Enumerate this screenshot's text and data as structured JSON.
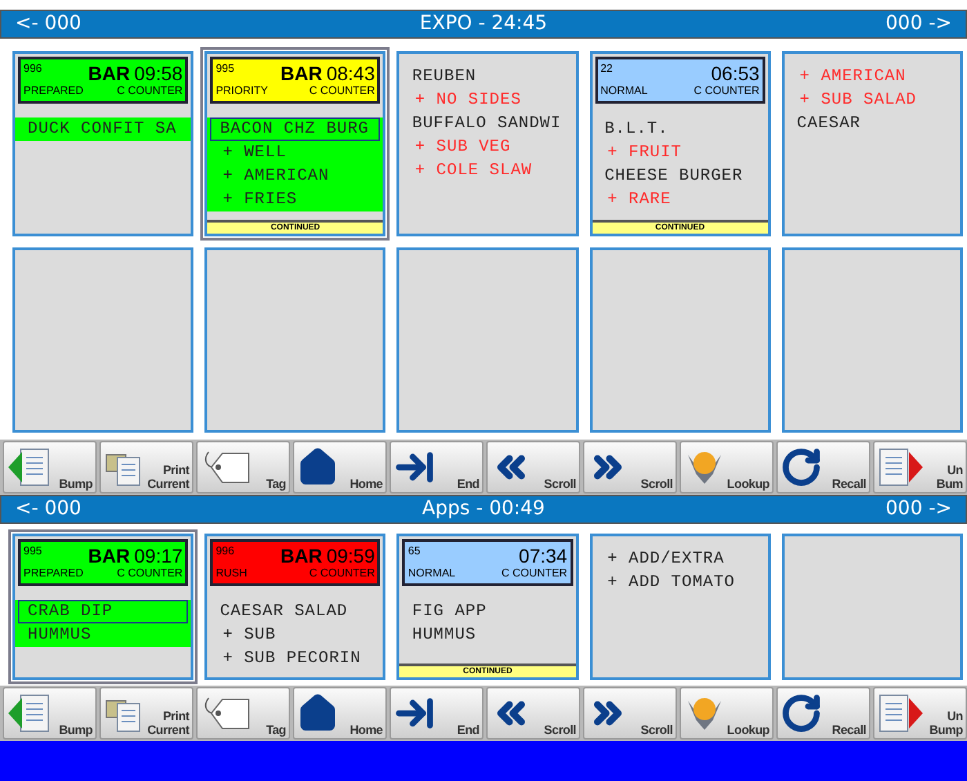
{
  "sections": [
    {
      "left": "<- 000",
      "title": "EXPO - 24:45",
      "right": "000 ->",
      "tickets": [
        {
          "kind": "order",
          "selected": false,
          "number": "996",
          "station": "BAR",
          "time": "09:58",
          "status": "PREPARED",
          "location": "C COUNTER",
          "color": "#00ff00",
          "continued": false,
          "items": [
            {
              "kind": "item",
              "text": "DUCK CONFIT SA",
              "highlight": true,
              "boxed": false
            }
          ]
        },
        {
          "kind": "order",
          "selected": true,
          "number": "995",
          "station": "BAR",
          "time": "08:43",
          "status": "PRIORITY",
          "location": "C COUNTER",
          "color": "#ffff00",
          "continued": true,
          "continued_label": "CONTINUED",
          "items": [
            {
              "kind": "item",
              "text": "BACON CHZ BURG",
              "highlight": true,
              "boxed": true
            },
            {
              "kind": "mod",
              "text": "+ WELL",
              "highlight": true,
              "boxed": false
            },
            {
              "kind": "mod",
              "text": "+ AMERICAN",
              "highlight": true,
              "boxed": false
            },
            {
              "kind": "mod",
              "text": "+ FRIES",
              "highlight": true,
              "boxed": false
            }
          ]
        },
        {
          "kind": "order",
          "selected": false,
          "continued": false,
          "items": [
            {
              "kind": "item",
              "text": "REUBEN",
              "highlight": false,
              "boxed": false
            },
            {
              "kind": "mod",
              "text": "+ NO SIDES",
              "highlight": false,
              "boxed": false
            },
            {
              "kind": "item",
              "text": "BUFFALO SANDWI",
              "highlight": false,
              "boxed": false
            },
            {
              "kind": "mod",
              "text": "+ SUB VEG",
              "highlight": false,
              "boxed": false
            },
            {
              "kind": "mod",
              "text": "+ COLE SLAW",
              "highlight": false,
              "boxed": false
            }
          ]
        },
        {
          "kind": "order",
          "selected": false,
          "number": "22",
          "time": "06:53",
          "status": "NORMAL",
          "location": "C COUNTER",
          "color": "#99ccff",
          "continued": true,
          "continued_label": "CONTINUED",
          "items": [
            {
              "kind": "item",
              "text": "B.L.T.",
              "highlight": false,
              "boxed": false
            },
            {
              "kind": "mod",
              "text": "+ FRUIT",
              "highlight": false,
              "boxed": false
            },
            {
              "kind": "item",
              "text": "CHEESE BURGER",
              "highlight": false,
              "boxed": false
            },
            {
              "kind": "mod",
              "text": "+ RARE",
              "highlight": false,
              "boxed": false
            }
          ]
        },
        {
          "kind": "order",
          "selected": false,
          "continued": false,
          "items": [
            {
              "kind": "mod",
              "text": "+ AMERICAN",
              "highlight": false,
              "boxed": false
            },
            {
              "kind": "mod",
              "text": "+ SUB SALAD",
              "highlight": false,
              "boxed": false
            },
            {
              "kind": "item",
              "text": "CAESAR",
              "highlight": false,
              "boxed": false
            }
          ]
        },
        {
          "kind": "empty"
        },
        {
          "kind": "empty"
        },
        {
          "kind": "empty"
        },
        {
          "kind": "empty"
        },
        {
          "kind": "empty"
        }
      ],
      "toolbar": [
        {
          "kind": "bump",
          "lines": [
            "Bump"
          ]
        },
        {
          "kind": "print",
          "lines": [
            "Print",
            "Current"
          ]
        },
        {
          "kind": "tag",
          "lines": [
            "Tag"
          ]
        },
        {
          "kind": "home",
          "lines": [
            "Home"
          ]
        },
        {
          "kind": "end",
          "lines": [
            "End"
          ]
        },
        {
          "kind": "back",
          "lines": [
            "Scroll"
          ]
        },
        {
          "kind": "forward",
          "lines": [
            "Scroll"
          ]
        },
        {
          "kind": "lookup",
          "lines": [
            "Lookup"
          ]
        },
        {
          "kind": "recall",
          "lines": [
            "Recall"
          ]
        },
        {
          "kind": "unbump",
          "lines": [
            "Un",
            "Bum"
          ]
        }
      ]
    },
    {
      "left": "<- 000",
      "title": "Apps - 00:49",
      "right": "000 ->",
      "tickets": [
        {
          "kind": "order",
          "selected": true,
          "number": "995",
          "station": "BAR",
          "time": "09:17",
          "status": "PREPARED",
          "location": "C COUNTER",
          "color": "#00ff00",
          "continued": false,
          "items": [
            {
              "kind": "item",
              "text": "CRAB DIP",
              "highlight": true,
              "boxed": true
            },
            {
              "kind": "item",
              "text": "HUMMUS",
              "highlight": true,
              "boxed": false
            }
          ]
        },
        {
          "kind": "order",
          "selected": false,
          "number": "996",
          "station": "BAR",
          "time": "09:59",
          "status": "RUSH",
          "location": "C COUNTER",
          "color": "#ff0000",
          "continued": false,
          "items": [
            {
              "kind": "item",
              "text": "CAESAR SALAD",
              "highlight": false,
              "boxed": false
            },
            {
              "kind": "subitem",
              "text": "+ SUB",
              "highlight": false,
              "boxed": false
            },
            {
              "kind": "subitem",
              "text": "+ SUB PECORIN",
              "highlight": false,
              "boxed": false
            }
          ]
        },
        {
          "kind": "order",
          "selected": false,
          "number": "65",
          "time": "07:34",
          "status": "NORMAL",
          "location": "C COUNTER",
          "color": "#99ccff",
          "continued": true,
          "continued_label": "CONTINUED",
          "items": [
            {
              "kind": "item",
              "text": "FIG APP",
              "highlight": false,
              "boxed": false
            },
            {
              "kind": "item",
              "text": "HUMMUS",
              "highlight": false,
              "boxed": false
            }
          ]
        },
        {
          "kind": "order",
          "selected": false,
          "continued": false,
          "items": [
            {
              "kind": "subitem",
              "text": "+ ADD/EXTRA",
              "highlight": false,
              "boxed": false
            },
            {
              "kind": "subitem",
              "text": "+ ADD TOMATO",
              "highlight": false,
              "boxed": false
            }
          ]
        },
        {
          "kind": "empty"
        }
      ],
      "toolbar": [
        {
          "kind": "bump",
          "lines": [
            "Bump"
          ]
        },
        {
          "kind": "print",
          "lines": [
            "Print",
            "Current"
          ]
        },
        {
          "kind": "tag",
          "lines": [
            "Tag"
          ]
        },
        {
          "kind": "home",
          "lines": [
            "Home"
          ]
        },
        {
          "kind": "end",
          "lines": [
            "End"
          ]
        },
        {
          "kind": "back",
          "lines": [
            "Scroll"
          ]
        },
        {
          "kind": "forward",
          "lines": [
            "Scroll"
          ]
        },
        {
          "kind": "lookup",
          "lines": [
            "Lookup"
          ]
        },
        {
          "kind": "recall",
          "lines": [
            "Recall"
          ]
        },
        {
          "kind": "unbump",
          "lines": [
            "Un",
            "Bump"
          ]
        }
      ]
    }
  ]
}
